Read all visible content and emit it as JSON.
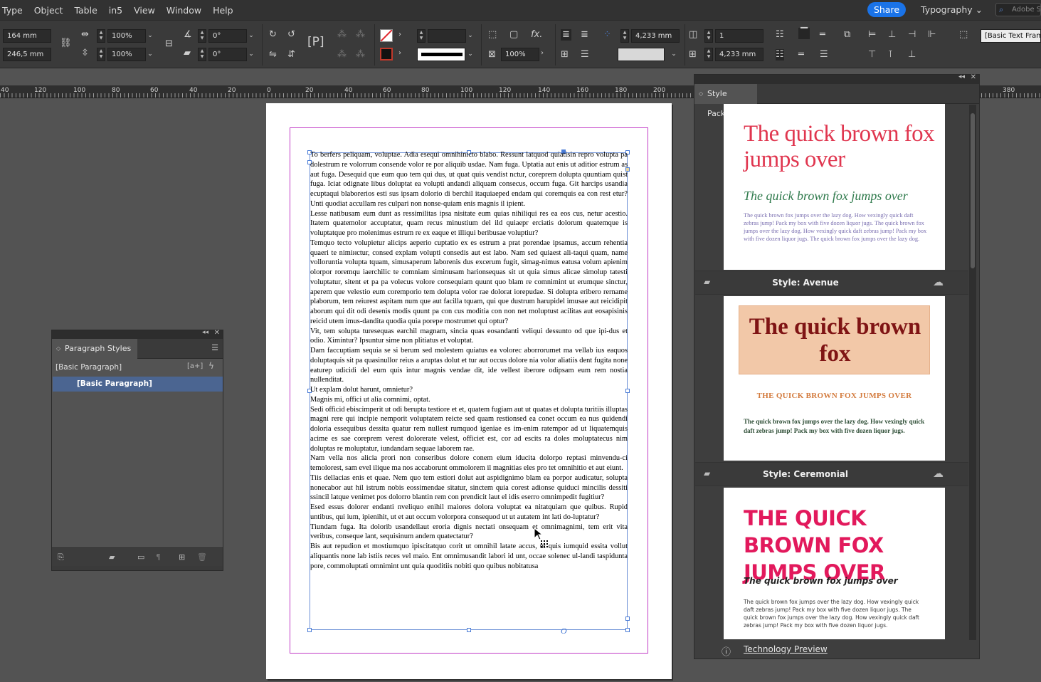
{
  "menubar": {
    "items": [
      "Type",
      "Object",
      "Table",
      "in5",
      "View",
      "Window",
      "Help"
    ],
    "share_label": "Share",
    "workspace_label": "Typography",
    "search_placeholder": "Adobe S"
  },
  "control": {
    "x_value": "164 mm",
    "y_value": "246,5 mm",
    "scale_x": "100%",
    "scale_y": "100%",
    "rotate": "0°",
    "shear": "0°",
    "frame_opacity": "100%",
    "gutter": "4,233 mm",
    "columns": "1",
    "inset": "4,233 mm",
    "object_style": "[Basic Text Frame]"
  },
  "ruler": {
    "labels": [
      "40",
      "120",
      "100",
      "80",
      "60",
      "40",
      "20",
      "0",
      "20",
      "40",
      "60",
      "80",
      "100",
      "120",
      "140",
      "160",
      "180",
      "200",
      "380"
    ]
  },
  "document": {
    "paragraphs": [
      "To berfers peliquam, voluptae. Adia esequi omnihinicto blabo. Ressunt latquod quiatisin repro volupta pa dolestrum re volorrum consende volor re por aliquib usdae. Nam fuga. Uptatia aut enis ut aditior estrum as aut fuga. Desequid que eum quo tem qui dus, ut quat quis vendist nctur, coreprem dolupta quuntiam quist fuga. Iciat odignate libus doluptat ea volupti andandi aliquam consecus, occum fuga. Git harcips usandia ecuptaqui blaborerios esti sus ipsam dolorio di berchil itaquiaeped endam qui coremquis ea con rest etur? Unti quodiat accullam res culpari non nonse-quiam enis magnis il ipient.",
      "Lesse natibusam eum dunt as ressimilitas ipsa nisitate eum quias nihiliqui res ea eos cus, netur acestio. Itatem quatemolor accuptatur, quam recus minustium del ild quiaepr erciatis dolorum quatemque is voluptatque pro molenimus estrum re ex eaque et illiqui beribusae voluptiur?",
      "Temquo tecto volupietur alicips aeperio cuptatio ex es estrum a prat porendae ipsamus, accum rehentia quaeri te nimінctur, consed explam volupti consedis aut est labo. Nam sed quiaest ali-taqui quam, name vollоruntia volupta tquam, simusaperum laborenis dus excerum fugit, simag-nimus eatusa volum apienim olorpor roremqu iaerchilic te comniam siminusam harionsequas sit ut quia simus alicae simolup tatesti voluptatur, sitent et pa pa volecus volore consequiam quunt quo blam re comnimint ut erumque sinctur, aperem que velestio eum coremporio tem dolupta volor rae dolorat iorepudae. Si dolupta eribero rername plaborum, tem reiurest aspitam num que aut facilla tquam, qui que dustrum harupidel imusae aut reicidipit aborum qui dit odi desenis modis quunt pa con cus moditia con non net moluptust acilitas aut eosapisinis reicid utem imus-dandita quodia quia porepe mostrumet qui optur?",
      "Vit, tem solupta turesequas earchil magnam, sincia quas eosandanti veliqui dessunto od que ipi-dus et odio. Ximintur? Ipsuntur sime non plitiatus et voluptat.",
      "Dam faccuptiam sequia se si berum sed molestem quiatus ea volorec aborrorumet ma vellab ius eaquos doluptaquis sit pa quasinullor reius a aruptas dolut et tur aut occus dolore nia volor aliatiis dent fugita none eaturep udicidi del eum quis intur magnis vendae dit, ide vellest iberore odipsam eum rem nostia nullenditat.",
      "Ut explam dolut harunt, omnietur?",
      "Magnis mi, offici ut alia comnimi, optat.",
      "Sedi officid ebiscimperit ut odi berupta testiore et et, quatem fugiam aut ut quatas et dolupta turitiis illuptas magni rere qui incipie nemporit voluptatem reicte sed quam restionsed ea conet occum ea nus quidendi doloria essequibus dessita quatur rem nullest rumquod igeniae es im-enim ratempor ad ut liquatemquis acime es sae coreprem verest dolorerate velest, officiet est, cor ad escits ra doles moluptatecus nim doluptas re moluptatur, iundandam sequae laborem rae.",
      "Nam vella nos alicia prori non conseribus dolore conem eium iducita dolorpo reptasi minvendu-ci temolorest, sam evel ilique ma nos accaborunt ommolorem il magnitias eles pro tet omnihitio et aut eiunt.",
      "Tiis dellacias enis et quae. Nem quo tem estiori dolut aut aspidignimo blam ea porpor audicatur, solupta nonecabor aut hil istrum nobis eossimendae sitatur, sinctem quia corest adionse quiduci mincilis dessiti ssincil latque venimet pos dolorro blantin rem con prendicit laut el idis eserro omnimpedit fugitiur?",
      "Esed essus dolorer endanti nveliquo enihil maiores dolora voluptat ea nitatquiam que quibus. Rupid untibus, qui ium, ipienihit, ut et aut occum volorpora consequod ut ut autatem int lati do-luptatur?",
      "Tiundam fuga. Ita dolorib usandellaut eroria dignis nectati onsequam et omnimagnimi, tem erit vita veribus, conseque lant, sequisinum andem quatectatur?",
      "Bis aut repudion et mostiumquo ipiscitatquo corit ut omnihil latate accus, ut quis iumquid essita vollut aliquantis none lab istiis reces vel maio. Ent omnimusandit labori id unt, occae solenec ul-landi taspidunta pore, commoluptati omnimint unt quia quoditiis nobiti quo quibus nobitatusa"
    ],
    "overset_marker": "O"
  },
  "paragraph_styles": {
    "title": "Paragraph Styles",
    "current_style": "[Basic Paragraph]",
    "selected_item": "[Basic Paragraph]",
    "new_group_icon": "[a+]"
  },
  "style_packs": {
    "title": "Style Packs",
    "cards": [
      {
        "name": "Style: Avenue",
        "headline": "The quick brown fox jumps over",
        "subhead": "The quick brown fox jumps over",
        "body": "The quick brown fox jumps over the lazy dog. How vexingly quick daft zebras jump! Pack my box with five dozen liquor jugs. The quick brown fox jumps over the lazy dog. How vexingly quick daft zebras jump! Pack my box with five dozen liquor jugs. The quick brown fox jumps over the lazy dog."
      },
      {
        "name": "Style: Ceremonial",
        "headline": "The quick brown fox",
        "subhead": "THE QUICK BROWN FOX JUMPS OVER",
        "body": "The quick brown fox jumps over the lazy dog. How vexingly quick daft zebras jump! Pack my box with five dozen liquor jugs."
      },
      {
        "name": "",
        "headline": "THE QUICK BROWN FOX JUMPS OVER",
        "subhead": "The quick brown fox jumps over",
        "body": "The quick brown fox jumps over the lazy dog. How vexingly quick daft zebras jump! Pack my box with five dozen liquor jugs. The quick brown fox jumps over the lazy dog. How vexingly quick daft zebras jump! Pack my box with five dozen liquor jugs."
      }
    ],
    "footer_link": "Technology Preview"
  },
  "colors": {
    "share": "#1a73e8",
    "margin_guide": "#c13cc6",
    "frame_edge": "#6b8fd6",
    "selected_row": "#4b6591"
  }
}
